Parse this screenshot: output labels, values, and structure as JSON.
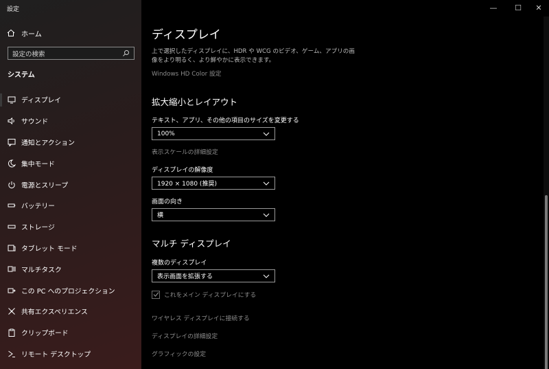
{
  "window": {
    "title": "設定"
  },
  "titlebar": {
    "minimize": "—",
    "maximize": "☐",
    "close": "✕"
  },
  "sidebar": {
    "home_label": "ホーム",
    "search_placeholder": "設定の検索",
    "section_title": "システム",
    "items": [
      {
        "label": "ディスプレイ",
        "icon": "monitor-icon"
      },
      {
        "label": "サウンド",
        "icon": "speaker-icon"
      },
      {
        "label": "通知とアクション",
        "icon": "notification-icon"
      },
      {
        "label": "集中モード",
        "icon": "moon-icon"
      },
      {
        "label": "電源とスリープ",
        "icon": "power-icon"
      },
      {
        "label": "バッテリー",
        "icon": "battery-icon"
      },
      {
        "label": "ストレージ",
        "icon": "storage-icon"
      },
      {
        "label": "タブレット モード",
        "icon": "tablet-icon"
      },
      {
        "label": "マルチタスク",
        "icon": "multitask-icon"
      },
      {
        "label": "この PC へのプロジェクション",
        "icon": "projection-icon"
      },
      {
        "label": "共有エクスペリエンス",
        "icon": "share-icon"
      },
      {
        "label": "クリップボード",
        "icon": "clipboard-icon"
      },
      {
        "label": "リモート デスクトップ",
        "icon": "remote-icon"
      }
    ]
  },
  "main": {
    "title": "ディスプレイ",
    "description": "上で選択したディスプレイに、HDR や WCG のビデオ、ゲーム、アプリの画像をより明るく、より鮮やかに表示できます。",
    "hd_color_link": "Windows HD Color 設定",
    "scale_section": "拡大縮小とレイアウト",
    "scale_label": "テキスト、アプリ、その他の項目のサイズを変更する",
    "scale_value": "100%",
    "scale_advanced_link": "表示スケールの詳細設定",
    "resolution_label": "ディスプレイの解像度",
    "resolution_value": "1920 × 1080 (推奨)",
    "orientation_label": "画面の向き",
    "orientation_value": "横",
    "multi_section": "マルチ ディスプレイ",
    "multi_label": "複数のディスプレイ",
    "multi_value": "表示画面を拡張する",
    "main_display_check": "これをメイン ディスプレイにする",
    "wireless_link": "ワイヤレス ディスプレイに接続する",
    "advanced_link": "ディスプレイの詳細設定",
    "graphics_link": "グラフィックの設定"
  }
}
